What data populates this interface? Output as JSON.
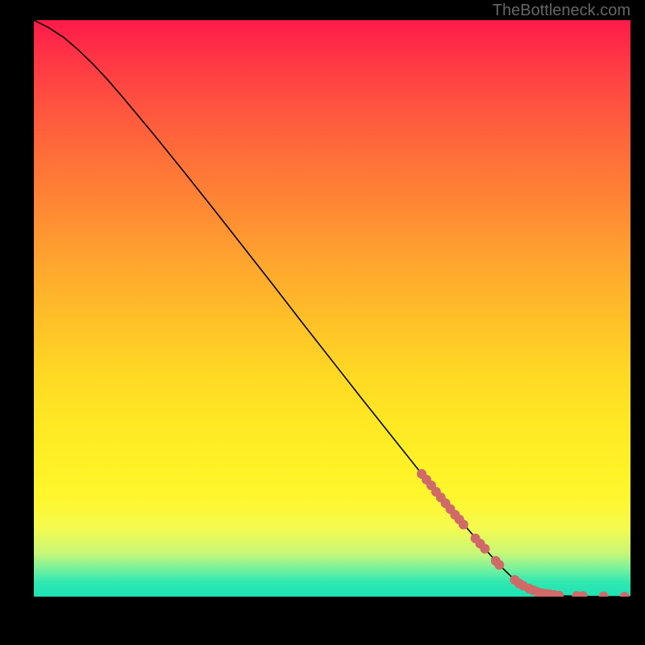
{
  "attribution": "TheBottleneck.com",
  "chart_data": {
    "type": "line",
    "title": "",
    "xlabel": "",
    "ylabel": "",
    "xlim": [
      0,
      100
    ],
    "ylim": [
      0,
      100
    ],
    "curve": [
      {
        "x": 0.0,
        "y": 100.0
      },
      {
        "x": 2.5,
        "y": 98.7
      },
      {
        "x": 5.0,
        "y": 97.0
      },
      {
        "x": 7.5,
        "y": 94.8
      },
      {
        "x": 10.0,
        "y": 92.3
      },
      {
        "x": 12.5,
        "y": 89.5
      },
      {
        "x": 15.0,
        "y": 86.5
      },
      {
        "x": 20.0,
        "y": 80.3
      },
      {
        "x": 25.0,
        "y": 73.9
      },
      {
        "x": 30.0,
        "y": 67.4
      },
      {
        "x": 35.0,
        "y": 60.8
      },
      {
        "x": 40.0,
        "y": 54.2
      },
      {
        "x": 45.0,
        "y": 47.5
      },
      {
        "x": 50.0,
        "y": 40.9
      },
      {
        "x": 55.0,
        "y": 34.3
      },
      {
        "x": 60.0,
        "y": 27.8
      },
      {
        "x": 65.0,
        "y": 21.3
      },
      {
        "x": 70.0,
        "y": 15.0
      },
      {
        "x": 75.0,
        "y": 9.0
      },
      {
        "x": 78.0,
        "y": 5.5
      },
      {
        "x": 80.5,
        "y": 3.0
      },
      {
        "x": 83.0,
        "y": 1.4
      },
      {
        "x": 85.5,
        "y": 0.5
      },
      {
        "x": 88.0,
        "y": 0.15
      },
      {
        "x": 92.0,
        "y": 0.05
      },
      {
        "x": 96.0,
        "y": 0.0
      },
      {
        "x": 100.0,
        "y": 0.0
      }
    ],
    "points": [
      {
        "x": 65.0,
        "y": 21.3
      },
      {
        "x": 65.8,
        "y": 20.3
      },
      {
        "x": 66.6,
        "y": 19.3
      },
      {
        "x": 67.4,
        "y": 18.2
      },
      {
        "x": 68.2,
        "y": 17.2
      },
      {
        "x": 69.0,
        "y": 16.2
      },
      {
        "x": 69.8,
        "y": 15.2
      },
      {
        "x": 70.6,
        "y": 14.2
      },
      {
        "x": 71.3,
        "y": 13.4
      },
      {
        "x": 72.0,
        "y": 12.5
      },
      {
        "x": 74.0,
        "y": 10.1
      },
      {
        "x": 74.8,
        "y": 9.2
      },
      {
        "x": 75.6,
        "y": 8.3
      },
      {
        "x": 77.4,
        "y": 6.2
      },
      {
        "x": 78.0,
        "y": 5.5
      },
      {
        "x": 80.6,
        "y": 2.9
      },
      {
        "x": 81.3,
        "y": 2.3
      },
      {
        "x": 82.0,
        "y": 1.9
      },
      {
        "x": 83.0,
        "y": 1.4
      },
      {
        "x": 83.7,
        "y": 1.1
      },
      {
        "x": 84.4,
        "y": 0.8
      },
      {
        "x": 85.1,
        "y": 0.6
      },
      {
        "x": 85.8,
        "y": 0.5
      },
      {
        "x": 86.5,
        "y": 0.4
      },
      {
        "x": 87.2,
        "y": 0.3
      },
      {
        "x": 88.0,
        "y": 0.2
      },
      {
        "x": 91.0,
        "y": 0.12
      },
      {
        "x": 92.0,
        "y": 0.1
      },
      {
        "x": 95.5,
        "y": 0.05
      },
      {
        "x": 99.0,
        "y": 0.0
      }
    ],
    "point_color": "#cf6a68",
    "curve_color": "#000000"
  }
}
